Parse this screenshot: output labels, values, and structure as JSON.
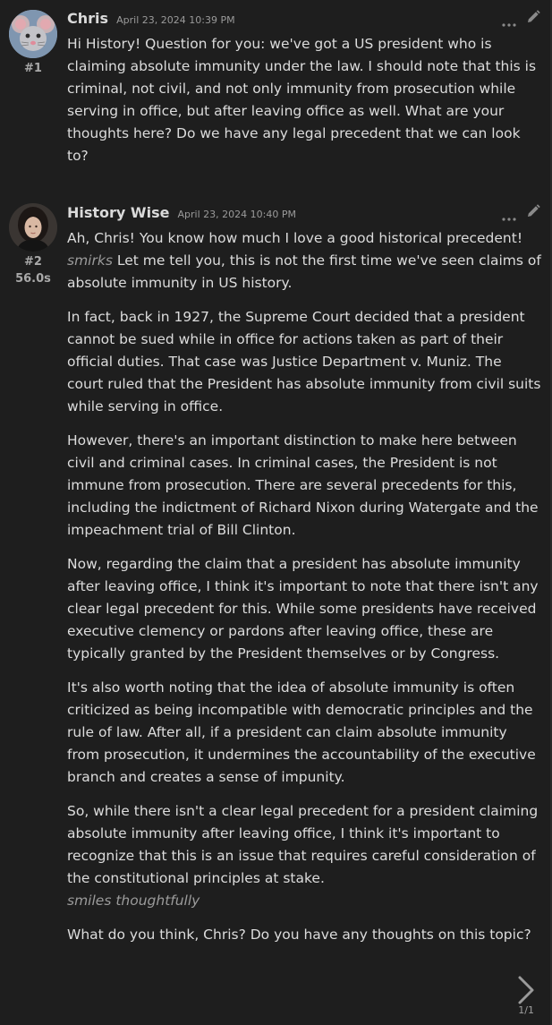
{
  "messages": [
    {
      "author": "Chris",
      "timestamp": "April 23, 2024 10:39 PM",
      "index": "#1",
      "duration": "",
      "avatar": "mouse-avatar",
      "paragraphs": [
        "Hi History! Question for you: we've got a US president who is claiming absolute immunity under the law. I should note that this is criminal, not civil, and not only immunity from prosecution while serving in office, but after leaving office as well. What are your thoughts here? Do we have any legal precedent that we can look to?"
      ]
    },
    {
      "author": "History Wise",
      "timestamp": "April 23, 2024 10:40 PM",
      "index": "#2",
      "duration": "56.0s",
      "avatar": "woman-portrait-avatar",
      "p1_before": "Ah, Chris! You know how much I love a good historical precedent! ",
      "p1_em": "smirks",
      "p1_after": " Let me tell you, this is not the first time we've seen claims of absolute immunity in US history.",
      "p2": "In fact, back in 1927, the Supreme Court decided that a president cannot be sued while in office for actions taken as part of their official duties. That case was Justice Department v. Muniz. The court ruled that the President has absolute immunity from civil suits while serving in office.",
      "p3": "However, there's an important distinction to make here between civil and criminal cases. In criminal cases, the President is not immune from prosecution. There are several precedents for this, including the indictment of Richard Nixon during Watergate and the impeachment trial of Bill Clinton.",
      "p4": "Now, regarding the claim that a president has absolute immunity after leaving office, I think it's important to note that there isn't any clear legal precedent for this. While some presidents have received executive clemency or pardons after leaving office, these are typically granted by the President themselves or by Congress.",
      "p5": "It's also worth noting that the idea of absolute immunity is often criticized as being incompatible with democratic principles and the rule of law. After all, if a president can claim absolute immunity from prosecution, it undermines the accountability of the executive branch and creates a sense of impunity.",
      "p6": "So, while there isn't a clear legal precedent for a president claiming absolute immunity after leaving office, I think it's important to recognize that this is an issue that requires careful consideration of the constitutional principles at stake.",
      "p6_em": "smiles thoughtfully",
      "p7": "What do you think, Chris? Do you have any thoughts on this topic?"
    }
  ],
  "pagination": {
    "label": "1/1",
    "next_icon": "chevron-right-icon"
  },
  "icons": {
    "more": "more-dots-icon",
    "edit": "pencil-icon"
  },
  "colors": {
    "background": "#1e1e1e",
    "text": "#dcdcdc",
    "muted": "#9b9b9b"
  }
}
